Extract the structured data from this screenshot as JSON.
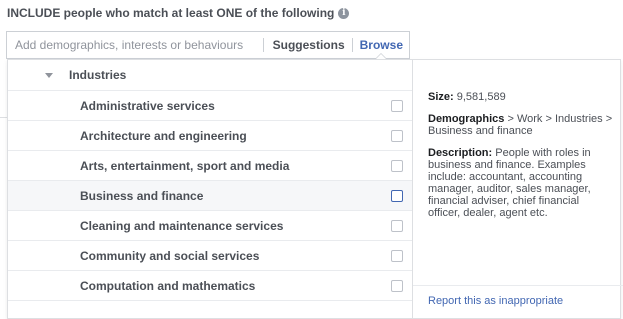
{
  "heading": "INCLUDE people who match at least ONE of the following",
  "search": {
    "placeholder": "Add demographics, interests or behaviours",
    "suggestions_label": "Suggestions",
    "browse_label": "Browse"
  },
  "category": "Industries",
  "items": [
    {
      "label": "Administrative services"
    },
    {
      "label": "Architecture and engineering"
    },
    {
      "label": "Arts, entertainment, sport and media"
    },
    {
      "label": "Business and finance"
    },
    {
      "label": "Cleaning and maintenance services"
    },
    {
      "label": "Community and social services"
    },
    {
      "label": "Computation and mathematics"
    }
  ],
  "detail": {
    "size_label": "Size:",
    "size_value": "9,581,589",
    "path_label": "Demographics",
    "path_value": "> Work > Industries > Business and finance",
    "desc_label": "Description:",
    "desc_value": "People with roles in business and finance. Examples include: accountant, accounting manager, auditor, sales manager, financial adviser, chief financial officer, dealer, agent etc."
  },
  "report_link": "Report this as inappropriate",
  "colors": {
    "accent": "#4267b2",
    "text": "#4b4f56",
    "border": "#dddfe2"
  },
  "icons": {
    "info": "info-icon",
    "collapse": "caret-down-icon"
  }
}
